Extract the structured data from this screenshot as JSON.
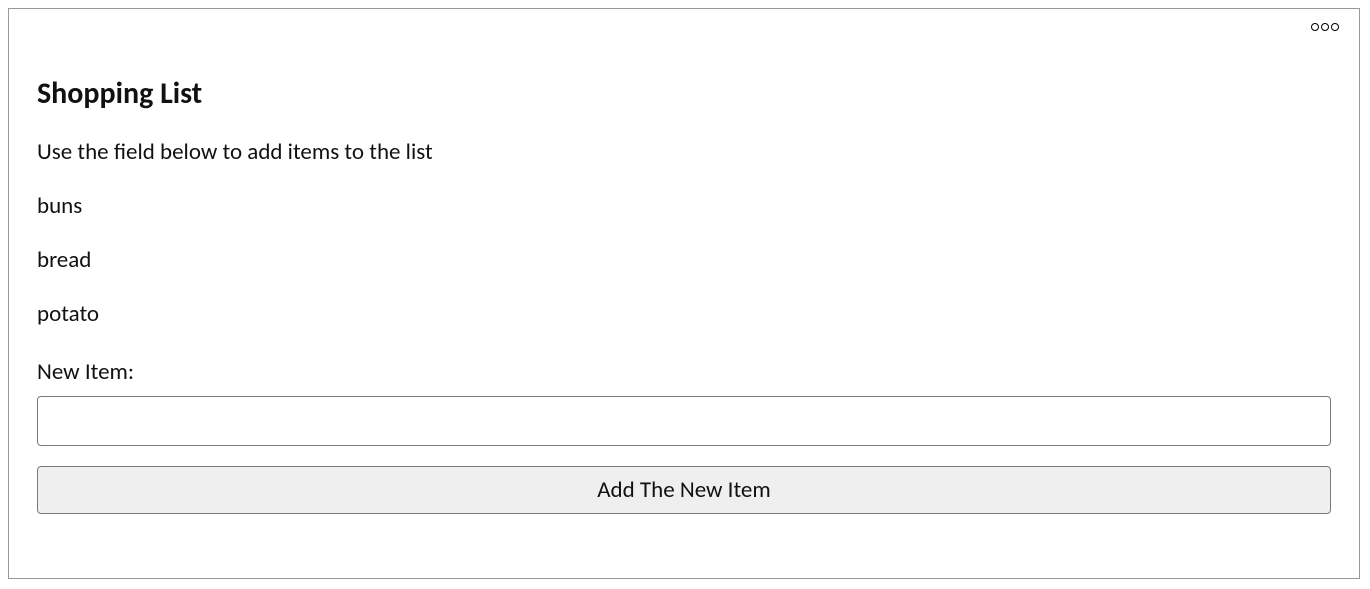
{
  "card": {
    "title": "Shopping List",
    "subtitle": "Use the field below to add items to the list",
    "items": [
      "buns",
      "bread",
      "potato"
    ],
    "new_item_label": "New Item:",
    "input_value": "",
    "add_button_label": "Add The New Item"
  }
}
